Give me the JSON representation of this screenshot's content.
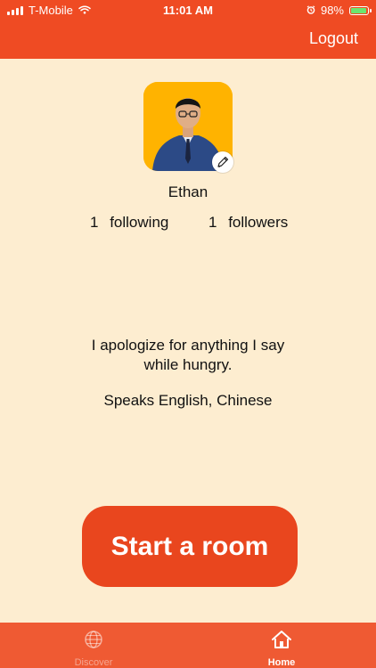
{
  "status_bar": {
    "carrier": "T-Mobile",
    "time": "11:01 AM",
    "battery": "98%"
  },
  "header": {
    "logout_label": "Logout"
  },
  "profile": {
    "name": "Ethan",
    "following_count": "1",
    "following_label": "following",
    "followers_count": "1",
    "followers_label": "followers",
    "bio_line1": "I apologize for anything I say",
    "bio_line2": "while hungry.",
    "languages": "Speaks English, Chinese"
  },
  "actions": {
    "start_room_label": "Start a room"
  },
  "bottom_nav": {
    "items": [
      {
        "label": "Discover",
        "icon": "globe-icon",
        "active": false
      },
      {
        "label": "Home",
        "icon": "home-icon",
        "active": true
      }
    ]
  },
  "colors": {
    "header_bg": "#EF4B23",
    "page_bg": "#FDEDD0",
    "button_bg": "#E9461E",
    "nav_bg": "#EF5A33",
    "avatar_bg": "#FFB300"
  }
}
